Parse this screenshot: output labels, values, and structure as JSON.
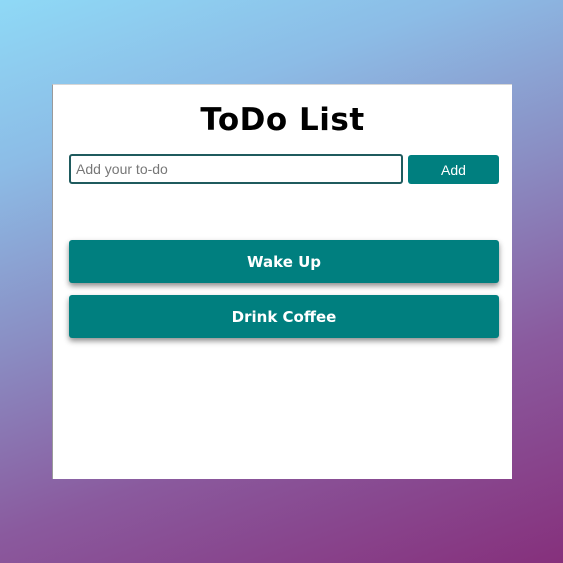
{
  "app": {
    "title": "ToDo List"
  },
  "input": {
    "placeholder": "Add your to-do",
    "value": ""
  },
  "add_button": {
    "label": "Add"
  },
  "todos": [
    {
      "label": "Wake Up"
    },
    {
      "label": "Drink Coffee"
    }
  ],
  "colors": {
    "accent": "#007f7f",
    "card_background": "#ffffff",
    "input_border": "#1f5b5e"
  }
}
